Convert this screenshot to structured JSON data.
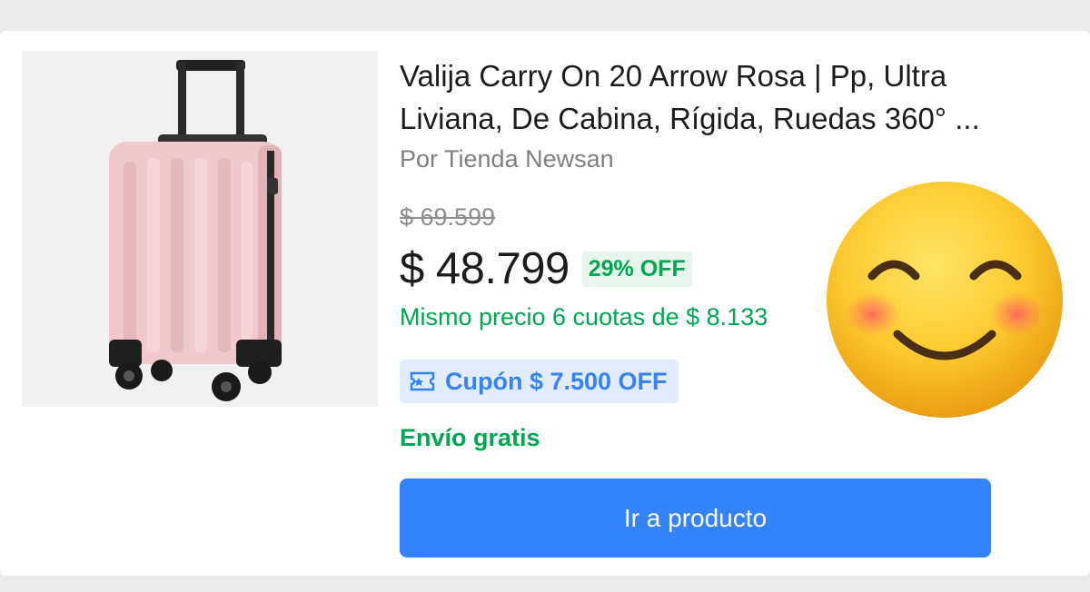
{
  "product": {
    "title": "Valija Carry On 20 Arrow Rosa | Pp, Ultra Liviana, De Cabina, Rígida, Ruedas 360° ...",
    "seller": "Por Tienda Newsan",
    "old_price": "$ 69.599",
    "price": "$ 48.799",
    "discount": "29% OFF",
    "installments": "Mismo precio 6 cuotas de $ 8.133",
    "coupon": "Cupón $ 7.500 OFF",
    "shipping": "Envío gratis",
    "image_icon": "pink-suitcase-image"
  },
  "cta": {
    "label": "Ir a producto"
  },
  "overlay": {
    "icon": "smiling-face-emoji"
  },
  "colors": {
    "accent_blue": "#3483fa",
    "green": "#00a650",
    "coupon_bg": "#e2ecfd",
    "discount_bg": "#e8f5ec"
  }
}
